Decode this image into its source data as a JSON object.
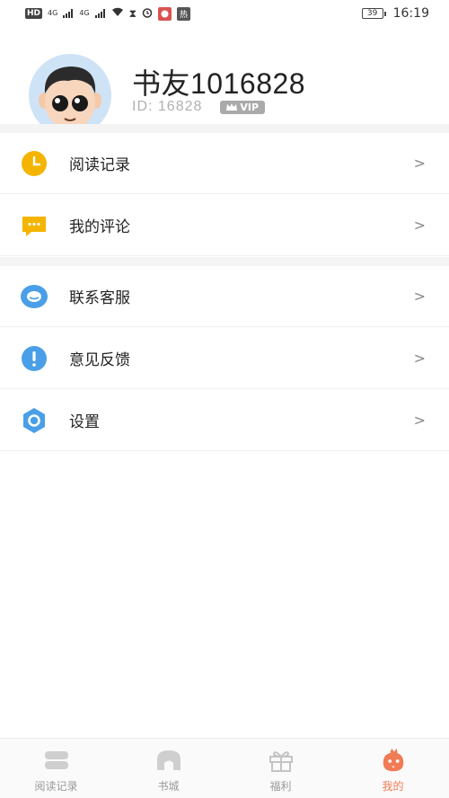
{
  "status_bar": {
    "left_badges": [
      "HD",
      "4G",
      "4G"
    ],
    "app_badge": "热",
    "battery": "39",
    "time": "16:19"
  },
  "profile": {
    "username": "书友1016828",
    "id_text": "ID: 16828",
    "vip_label": "VIP"
  },
  "menu": {
    "section1": [
      {
        "label": "阅读记录",
        "icon": "clock-icon",
        "color": "#f5b400"
      },
      {
        "label": "我的评论",
        "icon": "comment-icon",
        "color": "#f5b400"
      }
    ],
    "section2": [
      {
        "label": "联系客服",
        "icon": "service-icon",
        "color": "#4a9fe8"
      },
      {
        "label": "意见反馈",
        "icon": "feedback-icon",
        "color": "#4a9fe8"
      },
      {
        "label": "设置",
        "icon": "settings-icon",
        "color": "#4a9fe8"
      }
    ],
    "chevron": ">"
  },
  "tabbar": {
    "tabs": [
      {
        "label": "阅读记录",
        "icon": "books-icon",
        "active": false
      },
      {
        "label": "书城",
        "icon": "bookstore-icon",
        "active": false
      },
      {
        "label": "福利",
        "icon": "gift-icon",
        "active": false
      },
      {
        "label": "我的",
        "icon": "profile-mascot-icon",
        "active": true
      }
    ]
  },
  "colors": {
    "accent": "#f07b54",
    "inactive": "#999999",
    "yellow_icon": "#f5b400",
    "blue_icon": "#4a9fe8"
  }
}
